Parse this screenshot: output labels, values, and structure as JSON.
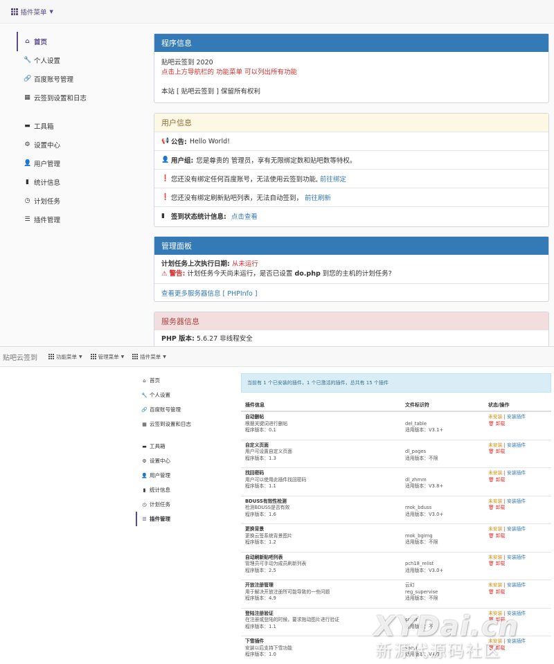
{
  "top": {
    "plugin_menu": "插件菜单",
    "sidebar": [
      {
        "icon": "home-icon",
        "label": "首页",
        "active": true
      },
      {
        "icon": "wrench-icon",
        "label": "个人设置"
      },
      {
        "icon": "link-icon",
        "label": "百度账号管理"
      },
      {
        "icon": "calendar-icon",
        "label": "云签到设置和日志"
      },
      {
        "icon": "briefcase-icon",
        "label": "工具箱"
      },
      {
        "icon": "gear-icon",
        "label": "设置中心"
      },
      {
        "icon": "user-icon",
        "label": "用户管理"
      },
      {
        "icon": "bar-chart-icon",
        "label": "统计信息"
      },
      {
        "icon": "clock-icon",
        "label": "计划任务"
      },
      {
        "icon": "list-icon",
        "label": "插件管理"
      }
    ],
    "program_info": {
      "title": "程序信息",
      "version": "贴吧云签到 2020",
      "tip": "点击上方导航栏的 功能菜单 可以列出所有功能",
      "copyright": "本站 [ 贴吧云签到 ] 保留所有权利"
    },
    "user_info": {
      "title": "用户信息",
      "notice_label": "公告:",
      "notice": "Hello World!",
      "group_label": "用户组:",
      "group": "您是尊贵的 管理员，享有无限绑定数和贴吧数等特权。",
      "bind_msg": "您还没有绑定任何百度账号，无法使用云签到功能,",
      "bind_link": "前往绑定",
      "refresh_msg": "您还没有绑定刷新贴吧列表，无法自动签到，",
      "refresh_link": "前往刷新",
      "stats_label": "签到状态统计信息:",
      "stats_link": "点击查看"
    },
    "admin_panel": {
      "title": "管理面板",
      "cron_label": "计划任务上次执行日期:",
      "cron_value": "从未运行",
      "warn_label": "警告:",
      "warn_text_1": "计划任务今天尚未运行，是否已设置",
      "warn_file": "do.php",
      "warn_text_2": "到您的主机的计划任务?",
      "more_link": "查看更多服务器信息 [ PHPInfo ]"
    },
    "server_info": {
      "title": "服务器信息",
      "php_label": "PHP 版本:",
      "php_value": "5.6.27 非线程安全"
    }
  },
  "bottom": {
    "brand": "贴吧云签到",
    "menus": [
      "功能菜单",
      "管理菜单",
      "插件菜单"
    ],
    "sidebar": [
      {
        "icon": "home-icon",
        "label": "首页"
      },
      {
        "icon": "wrench-icon",
        "label": "个人设置"
      },
      {
        "icon": "link-icon",
        "label": "百度账号管理"
      },
      {
        "icon": "calendar-icon",
        "label": "云签到设置和日志"
      },
      {
        "icon": "briefcase-icon",
        "label": "工具箱"
      },
      {
        "icon": "gear-icon",
        "label": "设置中心"
      },
      {
        "icon": "user-icon",
        "label": "用户管理"
      },
      {
        "icon": "bar-chart-icon",
        "label": "统计信息"
      },
      {
        "icon": "clock-icon",
        "label": "计划任务"
      },
      {
        "icon": "list-icon",
        "label": "插件管理",
        "active": true
      }
    ],
    "alert": "当前有 1 个已安装的插件，1 个已激活的插件，总共有 15 个插件",
    "columns": [
      "插件信息",
      "文件标识符",
      "状态/操作"
    ],
    "plugins": [
      {
        "name": "自动删帖",
        "desc": "根据关键词进行删帖",
        "ver": "程序版本：0.1",
        "id": "del_table",
        "applies": "适用版本：V3.1+"
      },
      {
        "name": "自定义页面",
        "desc": "用户可设置自定义页面",
        "ver": "程序版本：1.3",
        "id": "dl_pages",
        "applies": "适用版本：不限"
      },
      {
        "name": "找回密码",
        "desc": "用户可以使用此插件找回密码",
        "ver": "程序版本：1.1",
        "id": "dl_zhmm",
        "applies": "适用版本：V3.8+"
      },
      {
        "name": "BDUSS有效性检测",
        "desc": "检测BDUSS是否有效",
        "ver": "程序版本：1.6",
        "id": "mok_bduss",
        "applies": "适用版本：V3.0+"
      },
      {
        "name": "更换背景",
        "desc": "更换云签系统背景图片",
        "ver": "程序版本：1.2",
        "id": "mok_bgimg",
        "applies": "适用版本：不限"
      },
      {
        "name": "自动刷新贴吧列表",
        "desc": "管理员可手动为成员刷新列表",
        "ver": "程序版本：2.5",
        "id": "pch18_relist",
        "applies": "适用版本：V3.0+"
      },
      {
        "name": "开放注册管理",
        "desc": "用于解决开放注册所可能导致的一些问题",
        "ver": "程序版本：4.9",
        "author": "云幻",
        "id": "reg_supervise",
        "applies": "适用版本：不限"
      },
      {
        "name": "登陆注册验证",
        "desc": "在注册或登陆的时候，要求拖动图片进行验证",
        "ver": "程序版本：1.1",
        "id": "scher",
        "applies": "适用版本：不"
      },
      {
        "name": "下雪插件",
        "desc": "安装以后支持下雪功能",
        "ver": "程序版本：1.0",
        "id": "snow",
        "applies": "适用版本：V4.0"
      }
    ],
    "status": {
      "uninstalled": "未安装",
      "install": "安装插件",
      "uninstall": "卸载",
      "sep": "|"
    }
  },
  "watermark": {
    "line1": "XYDai.cn",
    "line2": "新源代源码社区"
  }
}
